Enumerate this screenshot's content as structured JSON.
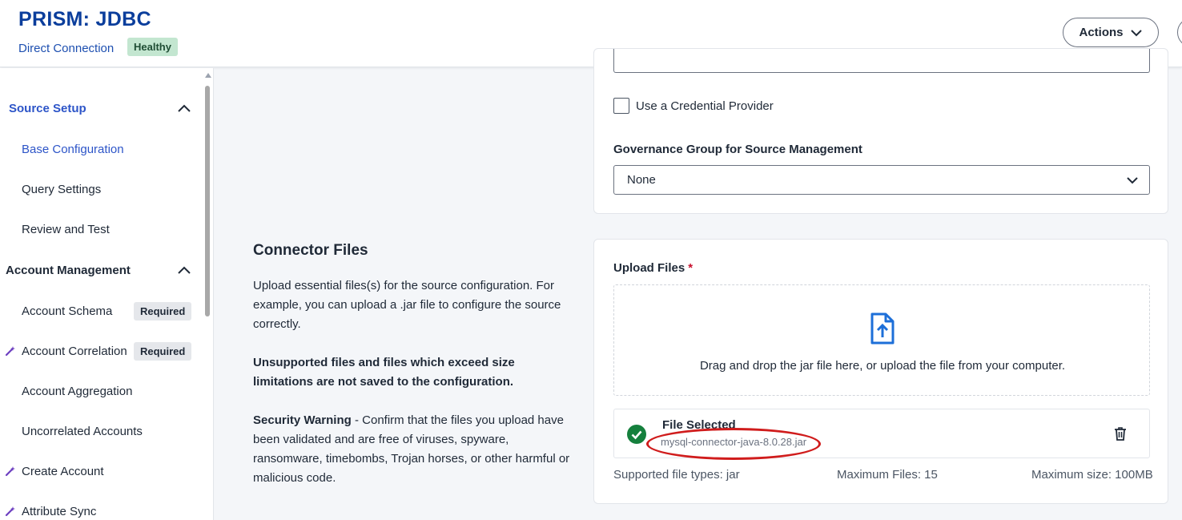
{
  "header": {
    "title": "PRISM: JDBC",
    "connection_type": "Direct Connection",
    "status_badge": "Healthy",
    "actions_label": "Actions"
  },
  "sidebar": {
    "sections": [
      {
        "label": "Source Setup",
        "color": "#2d55c8",
        "expanded": true
      },
      {
        "label": "Account Management",
        "color": "#1f2937",
        "expanded": true
      }
    ],
    "items": [
      {
        "label": "Base Configuration",
        "active": true
      },
      {
        "label": "Query Settings"
      },
      {
        "label": "Review and Test"
      },
      {
        "label": "Account Schema",
        "badge": "Required"
      },
      {
        "label": "Account Correlation",
        "badge": "Required",
        "icon": "magic-wand-icon"
      },
      {
        "label": "Account Aggregation"
      },
      {
        "label": "Uncorrelated Accounts"
      },
      {
        "label": "Create Account",
        "icon": "magic-wand-icon"
      },
      {
        "label": "Attribute Sync",
        "icon": "magic-wand-icon"
      }
    ]
  },
  "base_config": {
    "credential_provider_label": "Use a Credential Provider",
    "credential_provider_checked": false,
    "governance_group_label": "Governance Group for Source Management",
    "governance_group_value": "None"
  },
  "connector_files": {
    "title": "Connector Files",
    "description": "Upload essential files(s) for the source configuration. For example, you can upload a .jar file to configure the source correctly.",
    "unsupported_note": "Unsupported files and files which exceed size limitations are not saved to the configuration.",
    "security_warning_title": "Security Warning",
    "security_warning_text": " - Confirm that the files you upload have been validated and are free of viruses, spyware, ransomware, timebombs, Trojan horses, or other harmful or malicious code.",
    "upload_label": "Upload Files",
    "required_marker": "*",
    "drop_text": "Drag and drop the jar file here, or upload the file from your computer.",
    "file_selected_label": "File Selected",
    "file_name": "mysql-connector-java-8.0.28.jar",
    "supported_types": "Supported file types: jar",
    "max_files": "Maximum Files: 15",
    "max_size": "Maximum size: 100MB"
  },
  "colors": {
    "brand": "#0b3e9c",
    "accent": "#2d55c8",
    "success": "#15803d",
    "required": "#c8102e",
    "annotation": "#d01c1c"
  }
}
